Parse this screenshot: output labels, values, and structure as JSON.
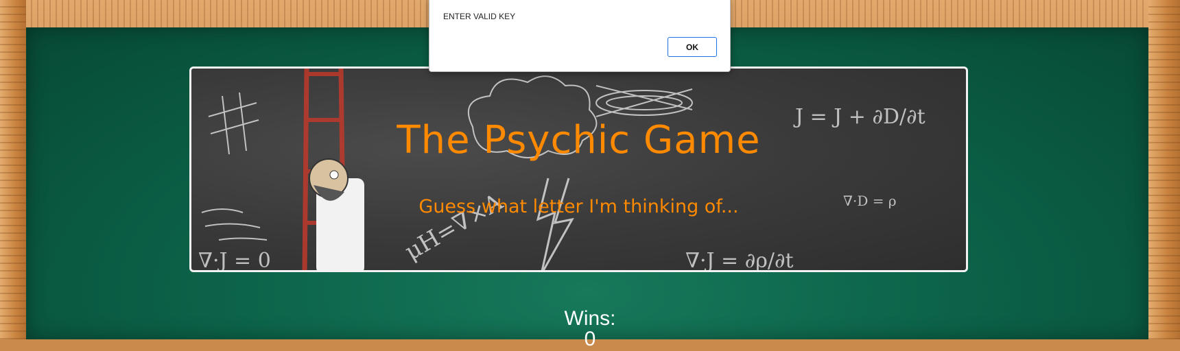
{
  "game": {
    "title": "The Psychic Game",
    "subtitle": "Guess what letter I'm thinking of...",
    "wins_label": "Wins:",
    "wins_value": "0"
  },
  "dialog": {
    "message": "ENTER VALID KEY",
    "ok_label": "OK"
  },
  "colors": {
    "board": "#0c6349",
    "title": "#ff8a00",
    "banner": "#3a3a3a"
  }
}
